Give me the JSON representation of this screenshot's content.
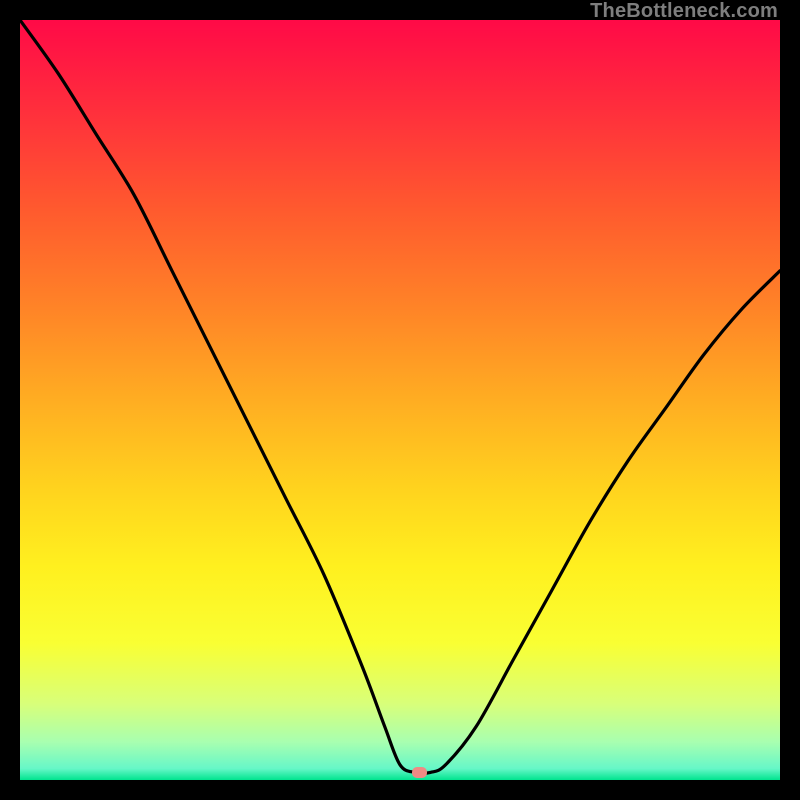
{
  "watermark": "TheBottleneck.com",
  "colors": {
    "gradient_stops": [
      {
        "offset": 0.0,
        "color": "#ff0a47"
      },
      {
        "offset": 0.12,
        "color": "#ff2f3c"
      },
      {
        "offset": 0.25,
        "color": "#ff5a2e"
      },
      {
        "offset": 0.38,
        "color": "#ff8427"
      },
      {
        "offset": 0.5,
        "color": "#ffad22"
      },
      {
        "offset": 0.62,
        "color": "#ffd41e"
      },
      {
        "offset": 0.72,
        "color": "#fff01f"
      },
      {
        "offset": 0.82,
        "color": "#f9ff33"
      },
      {
        "offset": 0.9,
        "color": "#d8ff7a"
      },
      {
        "offset": 0.95,
        "color": "#a8ffb0"
      },
      {
        "offset": 0.985,
        "color": "#66f7c8"
      },
      {
        "offset": 1.0,
        "color": "#00e48f"
      }
    ],
    "curve": "#000000",
    "marker": "#ef8a84",
    "frame": "#000000"
  },
  "chart_data": {
    "type": "line",
    "title": "",
    "xlabel": "",
    "ylabel": "",
    "xlim": [
      0,
      100
    ],
    "ylim": [
      0,
      100
    ],
    "marker": {
      "x": 52.5,
      "y": 1.0
    },
    "series": [
      {
        "name": "bottleneck-curve",
        "x": [
          0,
          5,
          10,
          15,
          20,
          25,
          30,
          35,
          40,
          45,
          48,
          50,
          52,
          54,
          56,
          60,
          65,
          70,
          75,
          80,
          85,
          90,
          95,
          100
        ],
        "y": [
          100,
          93,
          85,
          77,
          67,
          57,
          47,
          37,
          27,
          15,
          7,
          2,
          1,
          1,
          2,
          7,
          16,
          25,
          34,
          42,
          49,
          56,
          62,
          67
        ]
      }
    ]
  }
}
